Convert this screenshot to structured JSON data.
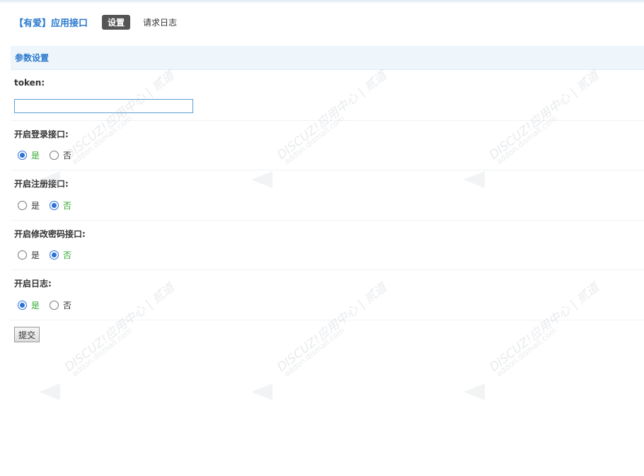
{
  "header": {
    "app_title": "【有爱】应用接口",
    "tabs": [
      {
        "label": "设置",
        "active": true
      },
      {
        "label": "请求日志",
        "active": false
      }
    ]
  },
  "section": {
    "title": "参数设置"
  },
  "form": {
    "token": {
      "label": "token:",
      "value": ""
    },
    "login_api": {
      "label": "开启登录接口:",
      "options": [
        "是",
        "否"
      ],
      "selected": "是"
    },
    "register_api": {
      "label": "开启注册接口:",
      "options": [
        "是",
        "否"
      ],
      "selected": "否"
    },
    "password_api": {
      "label": "开启修改密码接口:",
      "options": [
        "是",
        "否"
      ],
      "selected": "否"
    },
    "log": {
      "label": "开启日志:",
      "options": [
        "是",
        "否"
      ],
      "selected": "是"
    },
    "submit_label": "提交"
  },
  "watermark": {
    "brand": "DISCUZ!应用中心 | 贰道",
    "domain": "addon.dismall.com"
  },
  "colors": {
    "accent": "#2b7acd",
    "radio_checked": "#2b72d8",
    "selected_text": "#33a833",
    "section_bg": "#eef5fb"
  }
}
